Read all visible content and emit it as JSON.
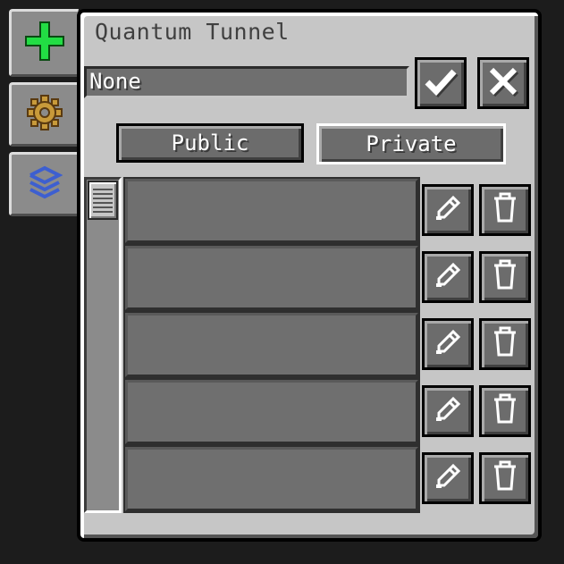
{
  "window": {
    "title": "Quantum Tunnel"
  },
  "name_field": {
    "value": "None"
  },
  "buttons": {
    "public_label": "Public",
    "private_label": "Private",
    "selected": "private"
  },
  "side_tabs": [
    {
      "icon": "green-plus-icon"
    },
    {
      "icon": "gear-icon"
    },
    {
      "icon": "stacked-layers-icon"
    }
  ],
  "list": {
    "rows": [
      {},
      {},
      {},
      {},
      {}
    ],
    "row_actions": [
      "pencil-icon",
      "trash-icon"
    ]
  },
  "colors": {
    "window_bg": "#c6c6c6",
    "slot_dark": "#6f6f6f",
    "plus_green": "#22dd44",
    "gear_gold": "#c89a3a",
    "layers_blue": "#3d5fd0"
  }
}
